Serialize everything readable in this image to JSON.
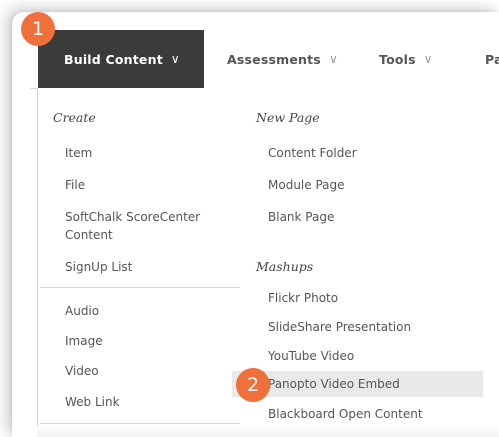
{
  "menubar": {
    "tabs": [
      {
        "label": "Build Content",
        "chevron": "∨"
      },
      {
        "label": "Assessments",
        "chevron": "∨"
      },
      {
        "label": "Tools",
        "chevron": "∨"
      },
      {
        "label": "Pa"
      }
    ]
  },
  "dropdown": {
    "left": {
      "create_heading": "Create",
      "create_items": [
        "Item",
        "File",
        "SoftChalk ScoreCenter",
        "Content",
        "SignUp List"
      ],
      "media_items": [
        "Audio",
        "Image",
        "Video",
        "Web Link"
      ]
    },
    "right": {
      "new_page_heading": "New Page",
      "new_page_items": [
        "Content Folder",
        "Module Page",
        "Blank Page"
      ],
      "mashups_heading": "Mashups",
      "mashups_items": [
        "Flickr Photo",
        "SlideShare Presentation",
        "YouTube Video",
        "Panopto Video Embed",
        "Blackboard Open Content"
      ]
    }
  },
  "annotations": {
    "step1": "1",
    "step2": "2",
    "color": "#f0703c"
  }
}
